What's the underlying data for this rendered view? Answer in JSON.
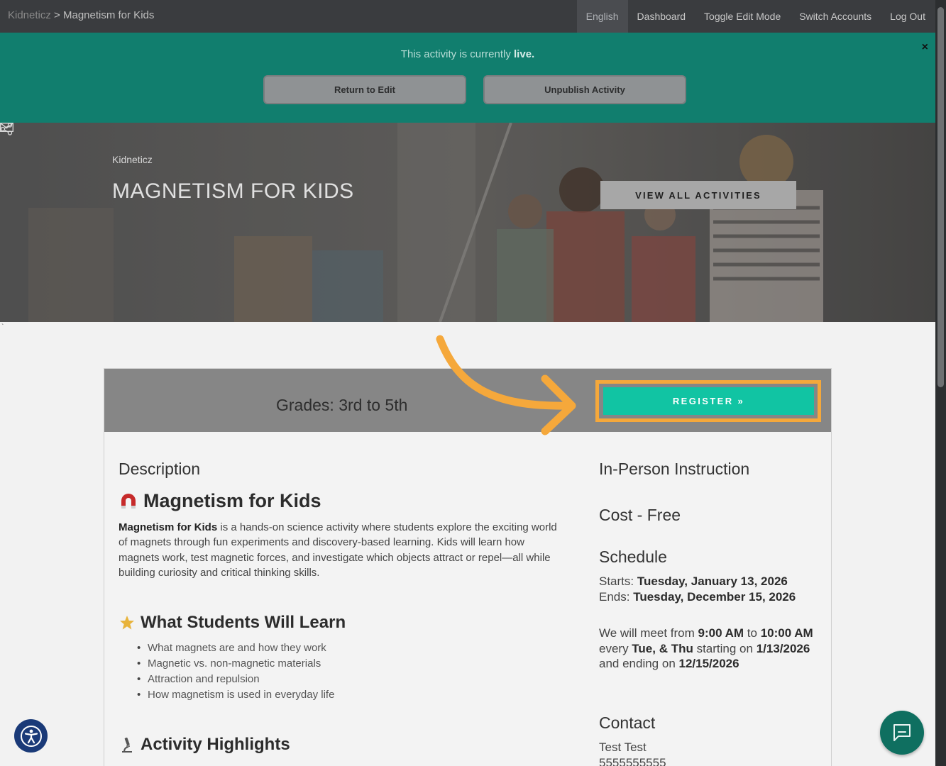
{
  "nav": {
    "brand": "Kidneticz",
    "separator": ">",
    "page": "Magnetism for Kids",
    "links": [
      "English",
      "Dashboard",
      "Toggle Edit Mode",
      "Switch Accounts",
      "Log Out"
    ]
  },
  "banner": {
    "message": "This activity is currently",
    "status": "live.",
    "close": "×",
    "return_button": "Return to Edit",
    "unpublish_button": "Unpublish Activity"
  },
  "hero": {
    "org": "Kidneticz",
    "title": "MAGNETISM FOR KIDS",
    "view_all": "VIEW ALL ACTIVITIES"
  },
  "stray": "`",
  "card": {
    "grades": "Grades: 3rd to 5th",
    "register": "REGISTER »",
    "description_heading": "Description",
    "main_heading": "Magnetism for Kids",
    "description_bold": "Magnetism for Kids",
    "description_text": " is a hands-on science activity where students explore the exciting world of magnets through fun experiments and discovery-based learning. Kids will learn how magnets work, test magnetic forces, and investigate which objects attract or repel—all while building curiosity and critical thinking skills.",
    "learn_heading": "What Students Will Learn",
    "learn_items": [
      "What magnets are and how they work",
      "Magnetic vs. non-magnetic materials",
      "Attraction and repulsion",
      "How magnetism is used in everyday life"
    ],
    "highlights_heading": "Activity Highlights"
  },
  "sidebar": {
    "instruction": "In-Person Instruction",
    "cost": "Cost - Free",
    "schedule_heading": "Schedule",
    "starts_label": "Starts: ",
    "starts_value": "Tuesday, January 13, 2026",
    "ends_label": "Ends: ",
    "ends_value": "Tuesday, December 15, 2026",
    "meet_1": "We will meet from ",
    "meet_start": "9:00 AM",
    "meet_2": " to ",
    "meet_end": "10:00 AM",
    "meet_3": " every ",
    "meet_days": "Tue, & Thu",
    "meet_4": " starting on ",
    "meet_from": "1/13/2026",
    "meet_5": " and ending on ",
    "meet_to": "12/15/2026",
    "contact_heading": "Contact",
    "contact_name": "Test Test",
    "contact_phone": "5555555555"
  },
  "colors": {
    "banner": "#117e6e",
    "register": "#11c4a3",
    "highlight": "#f5a83b",
    "nav": "#3a3c3f"
  }
}
